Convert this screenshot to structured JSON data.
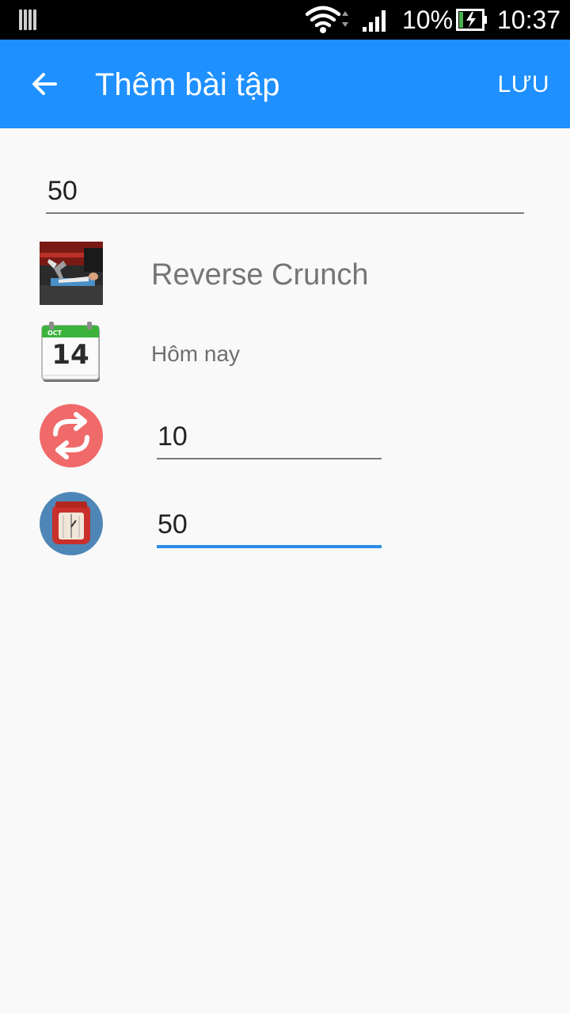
{
  "status_bar": {
    "battery_percent": "10%",
    "time": "10:37"
  },
  "app_bar": {
    "title": "Thêm bài tập",
    "save_label": "LƯU",
    "color": "#1e90ff"
  },
  "form": {
    "top_value": "50",
    "exercise_name": "Reverse Crunch",
    "date_text": "Hôm nay",
    "calendar_month": "OCT",
    "calendar_day": "14",
    "reps_value": "10",
    "weight_value": "50"
  }
}
